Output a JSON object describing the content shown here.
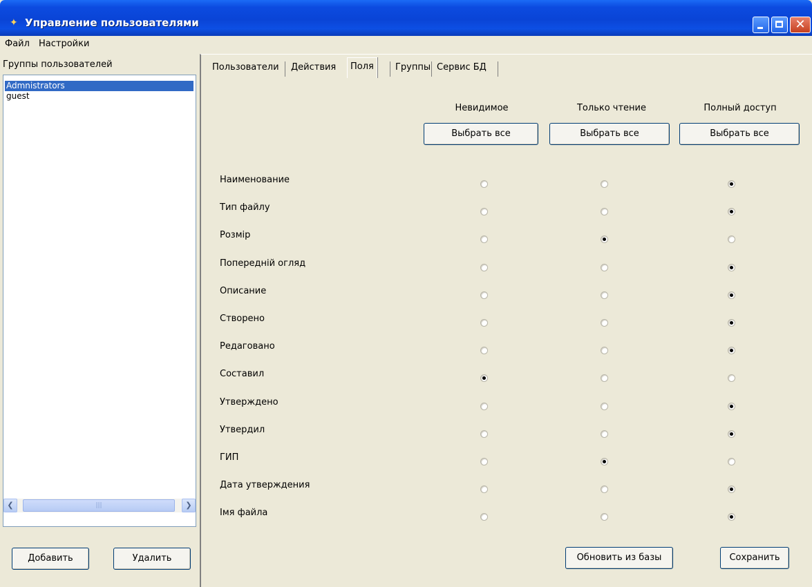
{
  "window": {
    "title": "Управление пользователями",
    "app_icon": "users-app-icon"
  },
  "menu": [
    "Файл",
    "Настройки"
  ],
  "groups": {
    "label": "Группы пользователей",
    "items": [
      {
        "name": "Admnistrators",
        "selected": true
      },
      {
        "name": "guest",
        "selected": false
      }
    ],
    "add_label": "Добавить",
    "delete_label": "Удалить"
  },
  "tabs": [
    {
      "label": "Пользователи",
      "active": false
    },
    {
      "label": "Действия",
      "active": false
    },
    {
      "label": "Поля",
      "active": true
    },
    {
      "label": "Группы",
      "active": false
    },
    {
      "label": "Сервис БД",
      "active": false
    }
  ],
  "columns": [
    {
      "header": "Невидимое",
      "select_all_label": "Выбрать все"
    },
    {
      "header": "Только чтение",
      "select_all_label": "Выбрать все"
    },
    {
      "header": "Полный доступ",
      "select_all_label": "Выбрать все"
    }
  ],
  "fields": [
    {
      "label": "Наименование",
      "access": 2
    },
    {
      "label": "Тип файлу",
      "access": 2
    },
    {
      "label": "Розмір",
      "access": 1
    },
    {
      "label": "Попередній огляд",
      "access": 2
    },
    {
      "label": "Описание",
      "access": 2
    },
    {
      "label": "Створено",
      "access": 2
    },
    {
      "label": "Редаговано",
      "access": 2
    },
    {
      "label": "Составил",
      "access": 0
    },
    {
      "label": "Утверждено",
      "access": 2
    },
    {
      "label": "Утвердил",
      "access": 2
    },
    {
      "label": "ГИП",
      "access": 1
    },
    {
      "label": "Дата утверждения",
      "access": 2
    },
    {
      "label": "Імя файла",
      "access": 2
    }
  ],
  "actions": {
    "refresh_label": "Обновить из базы",
    "save_label": "Сохранить"
  },
  "colors": {
    "titlebar": "#0a44d6",
    "selection": "#316ac5",
    "face": "#ece9d8"
  }
}
